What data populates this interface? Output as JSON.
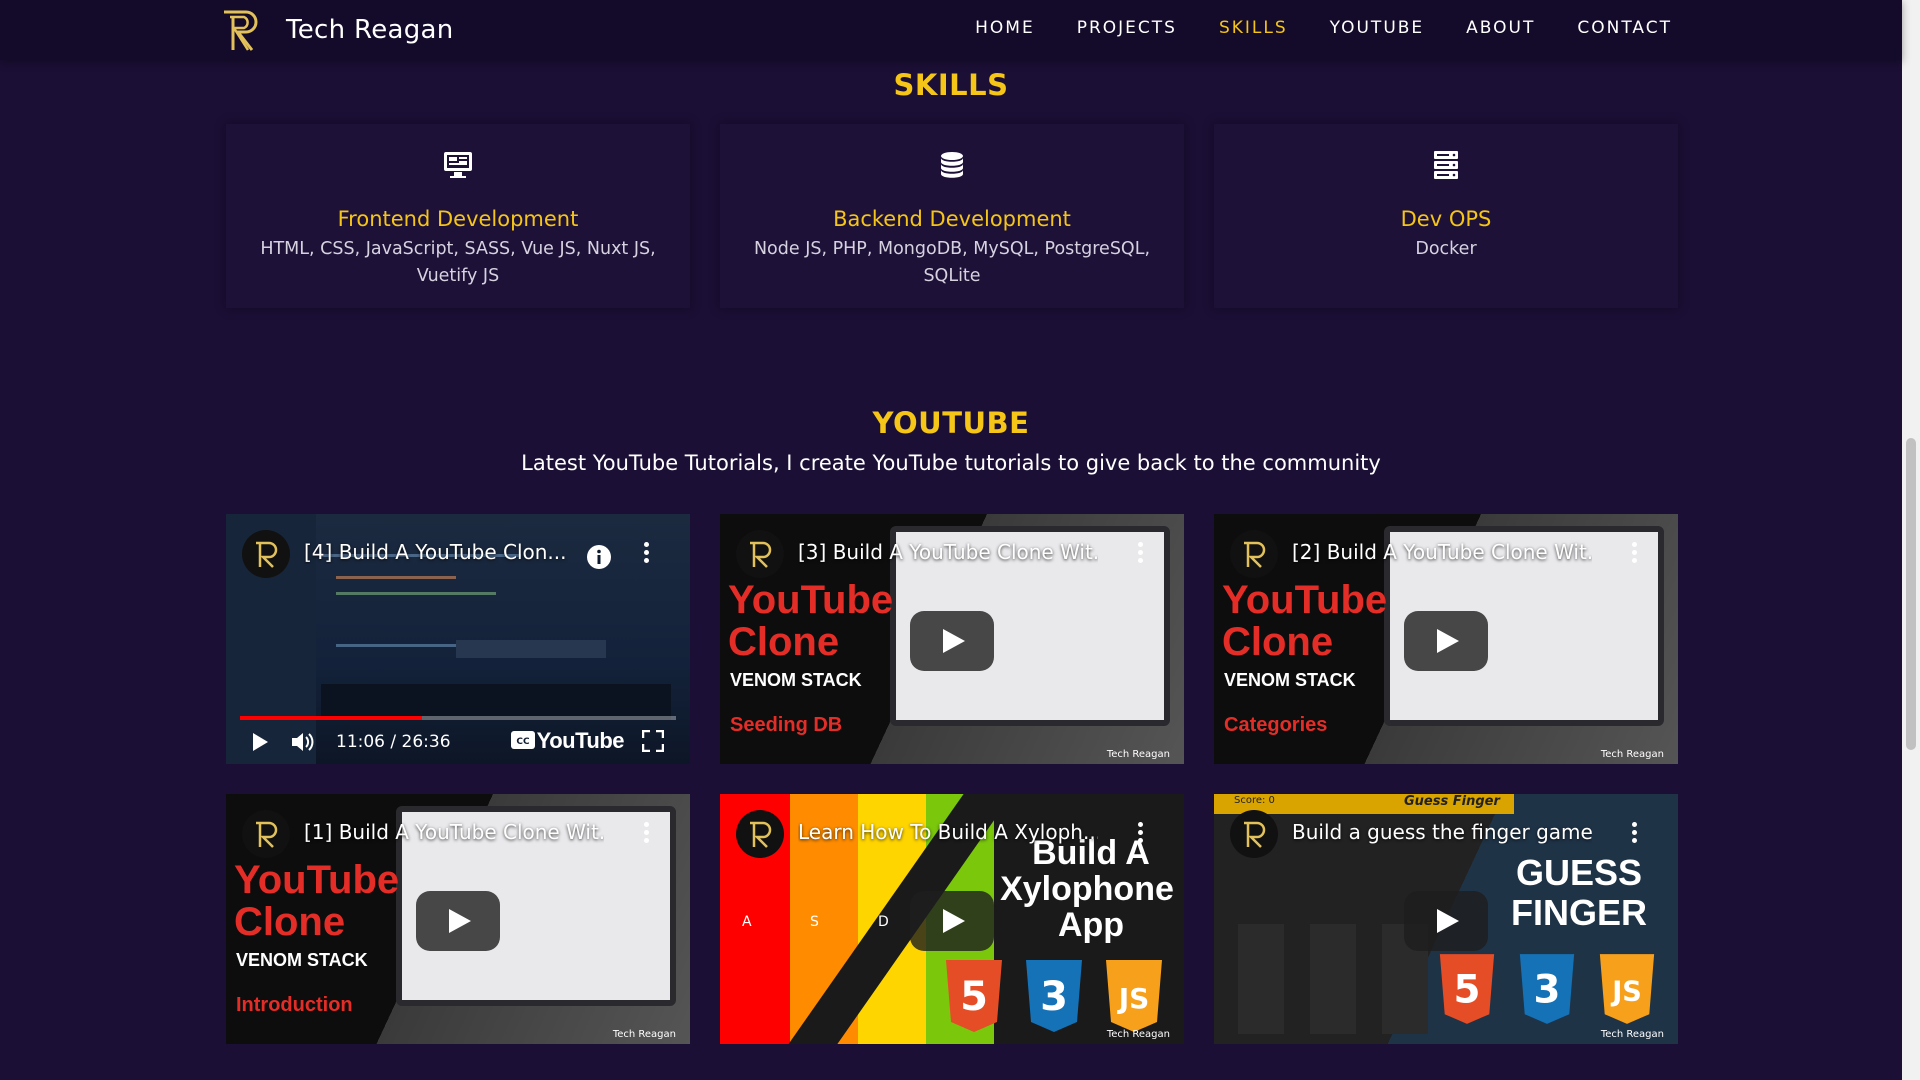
{
  "nav": {
    "brand": "Tech Reagan",
    "links": [
      "HOME",
      "PROJECTS",
      "SKILLS",
      "YOUTUBE",
      "ABOUT",
      "CONTACT"
    ],
    "active": "SKILLS"
  },
  "skills": {
    "title": "SKILLS",
    "cards": [
      {
        "icon": "monitor-icon",
        "name": "Frontend Development",
        "desc": "HTML, CSS, JavaScript, SASS, Vue JS, Nuxt JS, Vuetify JS"
      },
      {
        "icon": "database-icon",
        "name": "Backend Development",
        "desc": "Node JS, PHP, MongoDB, MySQL, PostgreSQL, SQLite"
      },
      {
        "icon": "server-icon",
        "name": "Dev OPS",
        "desc": "Docker"
      }
    ]
  },
  "youtube": {
    "title": "YOUTUBE",
    "subtitle": "Latest YouTube Tutorials, I create YouTube tutorials to give back to the community",
    "videos": [
      {
        "title": "[4] Build A YouTube Clon...",
        "time": "11:06 / 26:36",
        "wordmark": "YouTube",
        "progress": 0.417
      },
      {
        "title": "[3] Build A YouTube Clone Wit...",
        "line1": "YouTube",
        "line2": "Clone",
        "stack": "VENOM STACK",
        "episode": "Seeding DB",
        "credit": "Tech Reagan"
      },
      {
        "title": "[2] Build A YouTube Clone Wit...",
        "line1": "YouTube",
        "line2": "Clone",
        "stack": "VENOM STACK",
        "episode": "Categories",
        "credit": "Tech Reagan"
      },
      {
        "title": "[1] Build A YouTube Clone Wit...",
        "line1": "YouTube",
        "line2": "Clone",
        "stack": "VENOM STACK",
        "episode": "Introduction",
        "credit": "Tech Reagan"
      },
      {
        "title": "Learn How To Build A Xyloph...",
        "line1": "Build A",
        "line2": "Xylophone",
        "line3": "App",
        "keys": [
          "A",
          "S",
          "D"
        ],
        "credit": "Tech Reagan"
      },
      {
        "title": "Build a guess the finger game...",
        "line1": "GUESS",
        "line2": "FINGER",
        "header": "Guess Finger",
        "score": "Score: 0",
        "credit": "Tech Reagan"
      }
    ]
  },
  "colors": {
    "accent": "#f5c518",
    "background": "#1b0f35",
    "youtube_red": "#e52d27"
  }
}
